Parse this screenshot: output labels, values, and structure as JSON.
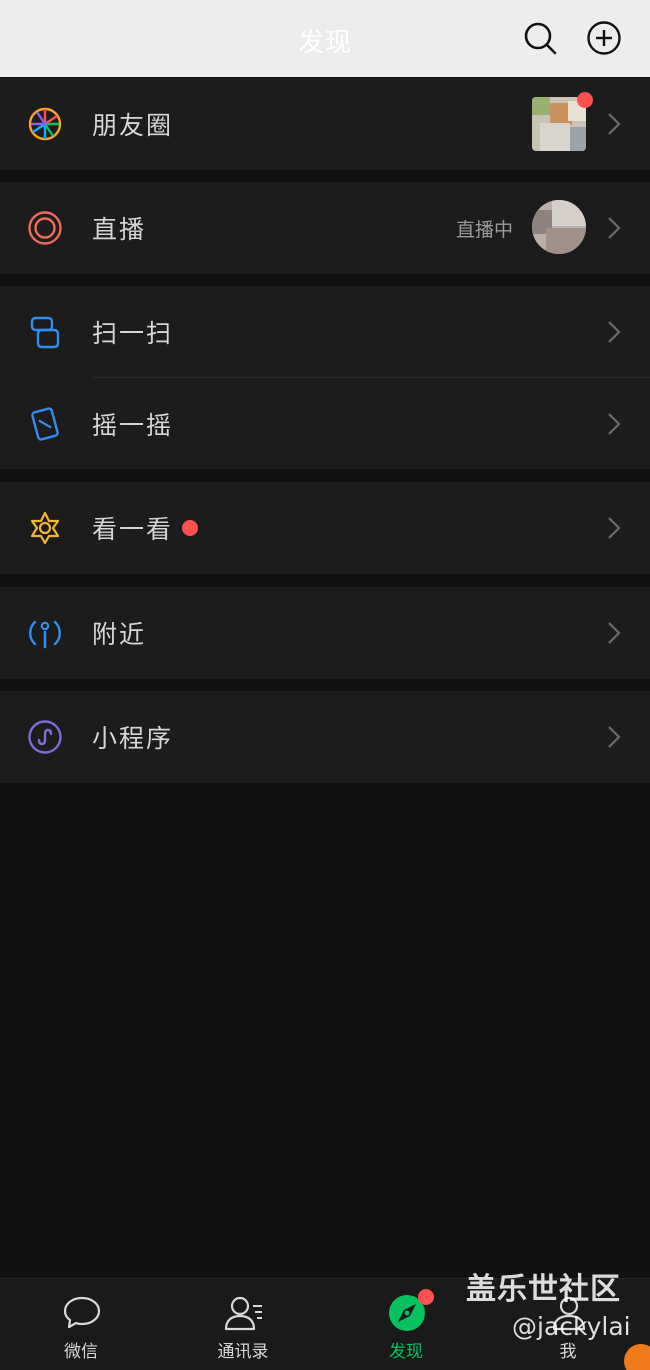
{
  "header": {
    "title": "发现",
    "search_icon": "search-icon",
    "add_icon": "plus-circle-icon"
  },
  "list": {
    "moments": {
      "label": "朋友圈",
      "icon": "moments-icon",
      "has_new_dot": true
    },
    "live": {
      "label": "直播",
      "status": "直播中",
      "icon": "live-icon"
    },
    "scan": {
      "label": "扫一扫",
      "icon": "scan-icon"
    },
    "shake": {
      "label": "摇一摇",
      "icon": "shake-icon"
    },
    "top_stories": {
      "label": "看一看",
      "icon": "top-stories-icon",
      "has_new_dot": true
    },
    "nearby": {
      "label": "附近",
      "icon": "nearby-icon"
    },
    "mini_programs": {
      "label": "小程序",
      "icon": "mini-program-icon"
    }
  },
  "tabbar": {
    "tabs": [
      {
        "label": "微信",
        "icon": "chat-icon",
        "active": false
      },
      {
        "label": "通讯录",
        "icon": "contacts-icon",
        "active": false
      },
      {
        "label": "发现",
        "icon": "discover-icon",
        "active": true,
        "has_new_dot": true
      },
      {
        "label": "我",
        "icon": "me-icon",
        "active": false
      }
    ]
  },
  "watermark": {
    "line1": "盖乐世社区",
    "line2": "@jackylai"
  },
  "colors": {
    "accent_green": "#07c160",
    "notification_red": "#fa5151",
    "background": "#111111",
    "cell_background": "#1c1c1c"
  }
}
